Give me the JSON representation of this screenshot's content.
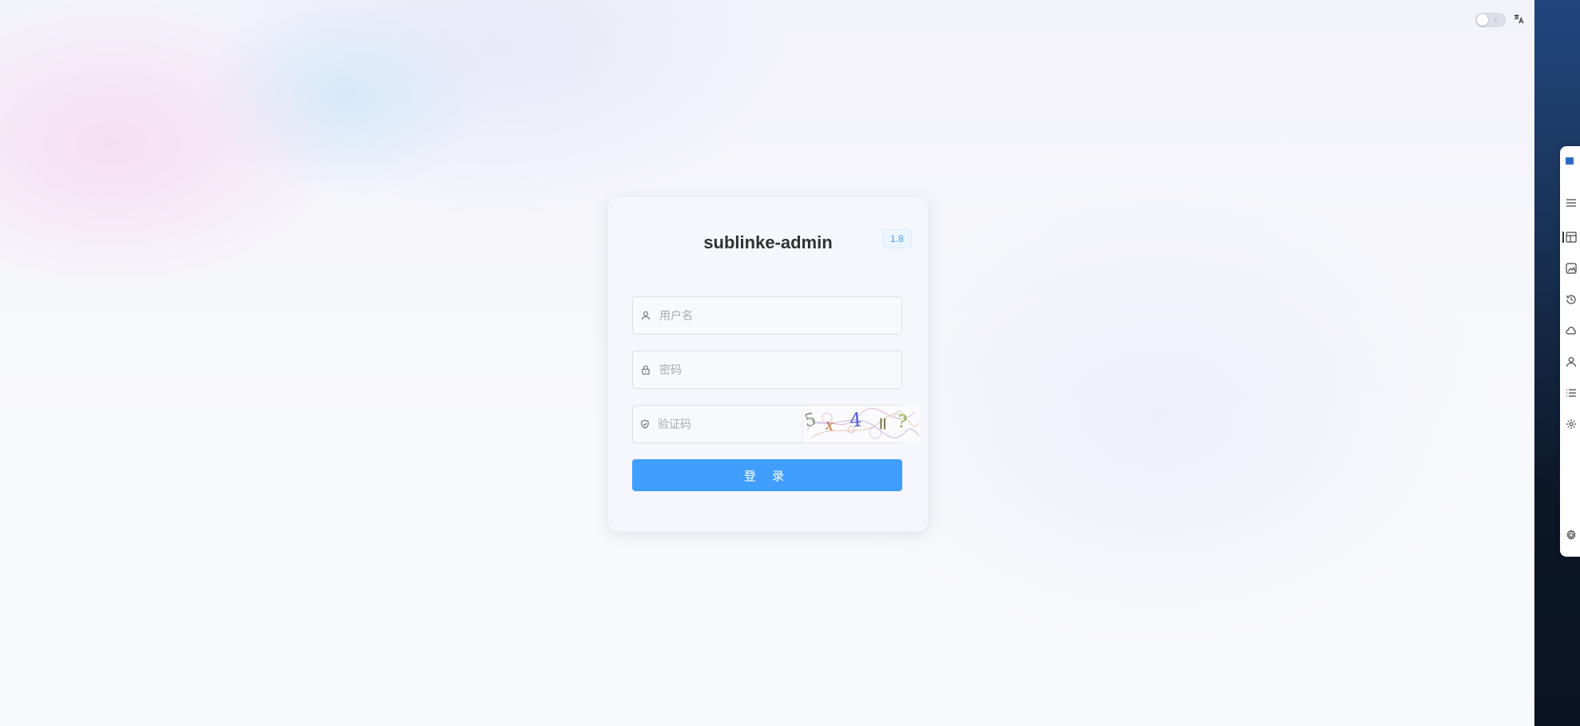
{
  "login": {
    "title": "sublinke-admin",
    "version": "1.8",
    "username_placeholder": "用户名",
    "password_placeholder": "密码",
    "captcha_placeholder": "验证码",
    "captcha_chars": [
      "5",
      "x",
      "4",
      "=",
      "?"
    ],
    "submit_label": "登 录"
  },
  "topbar": {
    "theme_toggle": "dark-mode-toggle",
    "language_icon": "translate-icon"
  },
  "side_panel": {
    "icons": [
      "logo-icon",
      "menu-icon",
      "table-icon",
      "image-icon",
      "history-icon",
      "cloud-icon",
      "user-icon",
      "list-icon",
      "settings-icon",
      "gear-icon"
    ]
  },
  "colors": {
    "primary": "#409eff",
    "card_bg": "#f5f6fc",
    "title_text": "#303133",
    "placeholder": "#a8abb2",
    "right_edge": "#1d3a66"
  }
}
